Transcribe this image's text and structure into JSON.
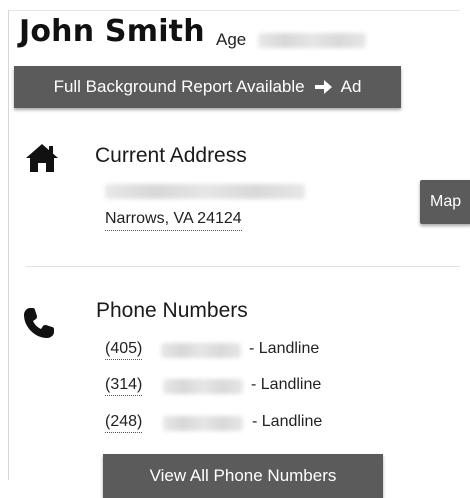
{
  "person": {
    "name": "John Smith",
    "age_label": "Age"
  },
  "report_button": {
    "label": "Full Background Report Available",
    "suffix": "Ad"
  },
  "address": {
    "title": "Current Address",
    "city_line": "Narrows, VA 24124",
    "map_label": "Map"
  },
  "phones": {
    "title": "Phone Numbers",
    "items": [
      {
        "area": "(405)",
        "type": "- Landline"
      },
      {
        "area": "(314)",
        "type": "- Landline"
      },
      {
        "area": "(248)",
        "type": "- Landline"
      }
    ],
    "view_all_label": "View All Phone Numbers"
  },
  "icons": {
    "address": "home-icon",
    "phones": "phone-icon",
    "report": "arrow-right-icon"
  },
  "colors": {
    "button_bg": "#5b5b5b",
    "button_text": "#ffffff"
  }
}
